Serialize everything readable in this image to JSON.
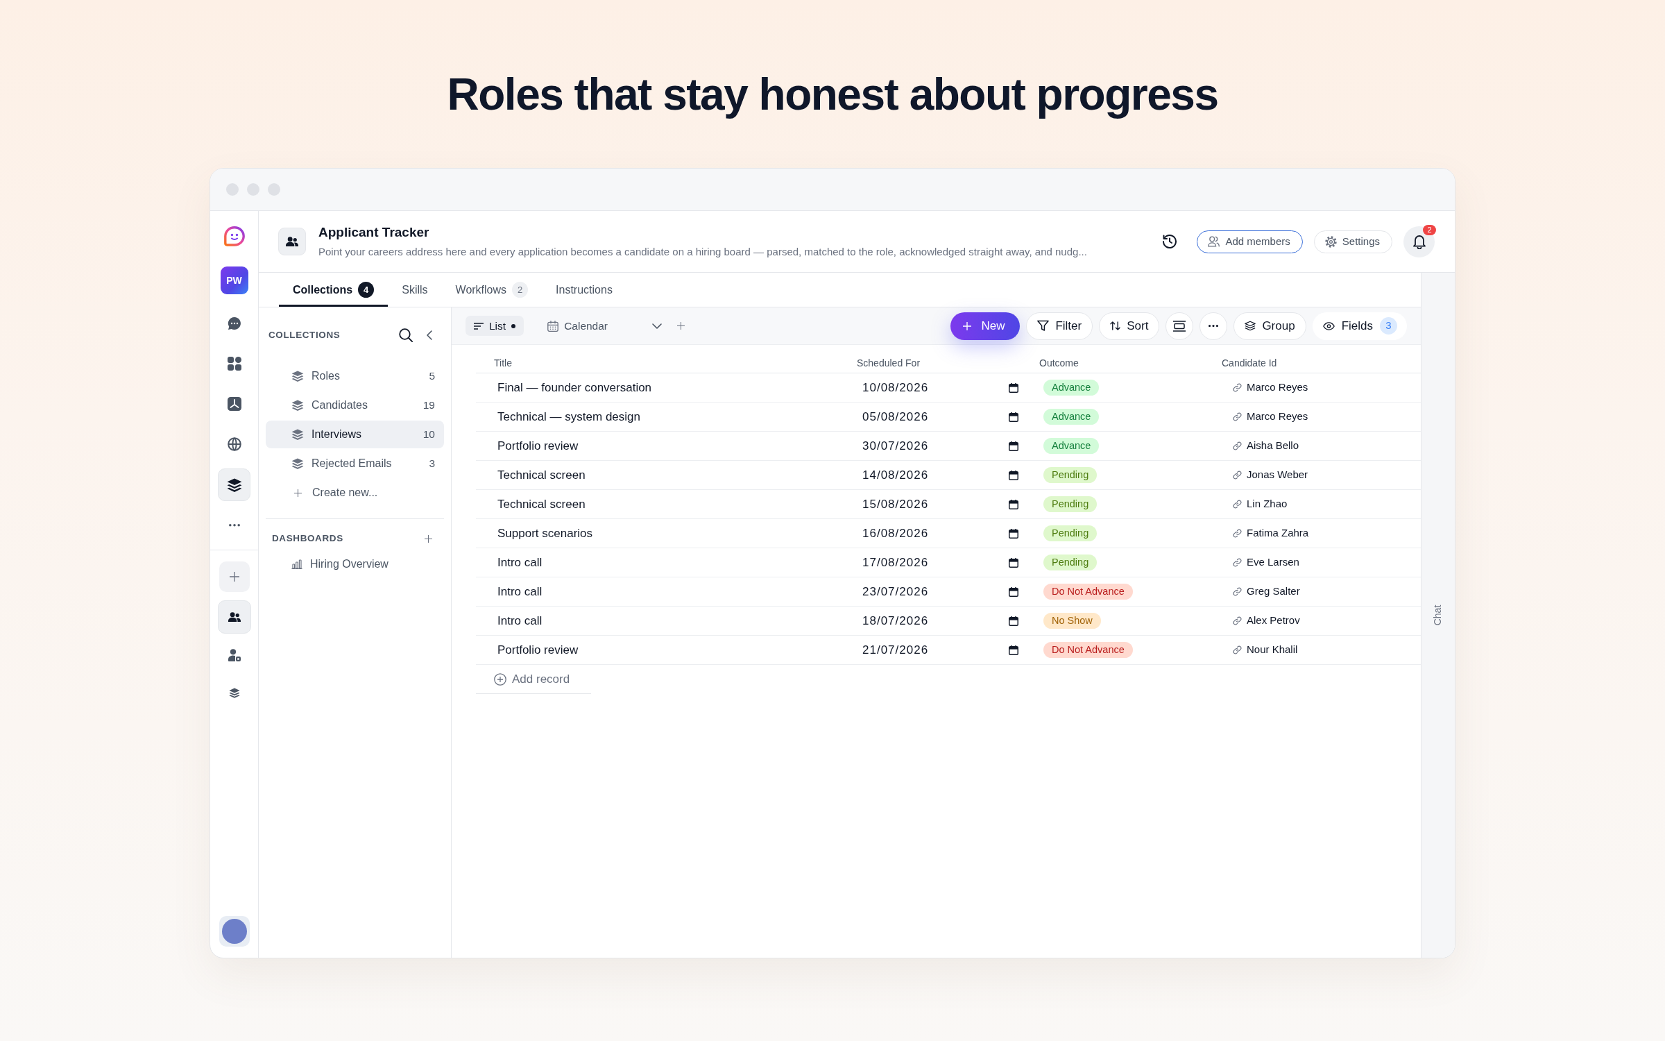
{
  "headline": "Roles that stay honest about progress",
  "rail": {
    "workspace": "PW",
    "nav": [
      {
        "selected": false
      },
      {
        "selected": false
      },
      {
        "selected": false
      },
      {
        "selected": false
      },
      {
        "selected": true
      },
      {
        "selected": false
      }
    ],
    "spaces": [
      {
        "selected": true
      },
      {
        "selected": false
      },
      {
        "selected": false
      }
    ]
  },
  "header": {
    "title": "Applicant Tracker",
    "description": "Point your careers address here and every application becomes a candidate on a hiring board — parsed, matched to the role, acknowledged straight away, and nudg...",
    "buttons": [
      {
        "label": "Add members",
        "kind": "primary"
      },
      {
        "label": "Settings",
        "kind": "default"
      }
    ],
    "notifications": "2"
  },
  "tabs": [
    {
      "label": "Collections",
      "badge": "4",
      "selected": true
    },
    {
      "label": "Skills",
      "selected": false
    },
    {
      "label": "Workflows",
      "badge": "2",
      "selected": false
    },
    {
      "label": "Instructions",
      "selected": false
    }
  ],
  "sidebar": {
    "collections": {
      "heading": "COLLECTIONS",
      "items": [
        {
          "label": "Roles",
          "count": "5",
          "selected": false
        },
        {
          "label": "Candidates",
          "count": "19",
          "selected": false
        },
        {
          "label": "Interviews",
          "count": "10",
          "selected": true
        },
        {
          "label": "Rejected Emails",
          "count": "3",
          "selected": false
        }
      ],
      "create": "Create new..."
    },
    "dashboards": {
      "heading": "DASHBOARDS",
      "items": [
        {
          "label": "Hiring Overview",
          "selected": false
        }
      ]
    }
  },
  "toolbar": {
    "views": [
      {
        "kind": "list",
        "label": "List",
        "selected": true,
        "dot": true
      },
      {
        "kind": "calendar",
        "label": "Calendar",
        "selected": false,
        "dot": false
      }
    ],
    "new": "New",
    "filter": "Filter",
    "sort": "Sort",
    "group": "Group",
    "fields": "Fields",
    "fields_count": "3"
  },
  "table": {
    "columns": [
      "Title",
      "Scheduled For",
      "Outcome",
      "Candidate Id"
    ],
    "rows": [
      {
        "title": "Final — founder conversation",
        "scheduled_for": "10/08/2026",
        "outcome": {
          "label": "Advance",
          "color": "#15803d"
        },
        "candidate_id": "Marco Reyes"
      },
      {
        "title": "Technical — system design",
        "scheduled_for": "05/08/2026",
        "outcome": {
          "label": "Advance",
          "color": "#15803d"
        },
        "candidate_id": "Marco Reyes"
      },
      {
        "title": "Portfolio review",
        "scheduled_for": "30/07/2026",
        "outcome": {
          "label": "Advance",
          "color": "#15803d"
        },
        "candidate_id": "Aisha Bello"
      },
      {
        "title": "Technical screen",
        "scheduled_for": "14/08/2026",
        "outcome": {
          "label": "Pending",
          "color": "#4d7c0f"
        },
        "candidate_id": "Jonas Weber"
      },
      {
        "title": "Technical screen",
        "scheduled_for": "15/08/2026",
        "outcome": {
          "label": "Pending",
          "color": "#4d7c0f"
        },
        "candidate_id": "Lin Zhao"
      },
      {
        "title": "Support scenarios",
        "scheduled_for": "16/08/2026",
        "outcome": {
          "label": "Pending",
          "color": "#4d7c0f"
        },
        "candidate_id": "Fatima Zahra"
      },
      {
        "title": "Intro call",
        "scheduled_for": "17/08/2026",
        "outcome": {
          "label": "Pending",
          "color": "#4d7c0f"
        },
        "candidate_id": "Eve Larsen"
      },
      {
        "title": "Intro call",
        "scheduled_for": "23/07/2026",
        "outcome": {
          "label": "Do Not Advance",
          "color": "#b91c1c"
        },
        "candidate_id": "Greg Salter"
      },
      {
        "title": "Intro call",
        "scheduled_for": "18/07/2026",
        "outcome": {
          "label": "No Show",
          "color": "#a16207"
        },
        "candidate_id": "Alex Petrov"
      },
      {
        "title": "Portfolio review",
        "scheduled_for": "21/07/2026",
        "outcome": {
          "label": "Do Not Advance",
          "color": "#b91c1c"
        },
        "candidate_id": "Nour Khalil"
      }
    ],
    "add_record": "Add record"
  },
  "chat": "Chat"
}
